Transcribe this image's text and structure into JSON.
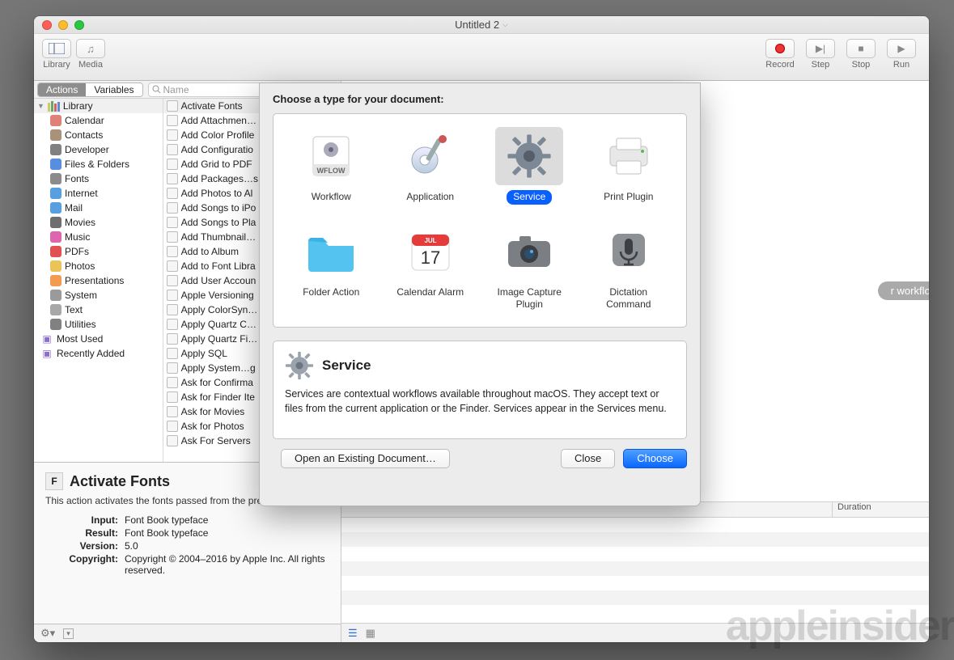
{
  "window": {
    "title": "Untitled 2"
  },
  "toolbar": {
    "left": [
      {
        "name": "library",
        "label": "Library"
      },
      {
        "name": "media",
        "label": "Media"
      }
    ],
    "right": [
      {
        "name": "record",
        "label": "Record"
      },
      {
        "name": "step",
        "label": "Step"
      },
      {
        "name": "stop",
        "label": "Stop"
      },
      {
        "name": "run",
        "label": "Run"
      }
    ]
  },
  "tabs": {
    "actions": "Actions",
    "variables": "Variables"
  },
  "search": {
    "placeholder": "Name"
  },
  "library": {
    "header": "Library",
    "categories": [
      {
        "label": "Calendar",
        "color": "#d86c5f"
      },
      {
        "label": "Contacts",
        "color": "#9a7f62"
      },
      {
        "label": "Developer",
        "color": "#6b6b6b"
      },
      {
        "label": "Files & Folders",
        "color": "#3a7ad9"
      },
      {
        "label": "Fonts",
        "color": "#777"
      },
      {
        "label": "Internet",
        "color": "#3a8edc"
      },
      {
        "label": "Mail",
        "color": "#3a8edc"
      },
      {
        "label": "Movies",
        "color": "#555"
      },
      {
        "label": "Music",
        "color": "#d64ca0"
      },
      {
        "label": "PDFs",
        "color": "#d33"
      },
      {
        "label": "Photos",
        "color": "#e7b93c"
      },
      {
        "label": "Presentations",
        "color": "#f08a33"
      },
      {
        "label": "System",
        "color": "#888"
      },
      {
        "label": "Text",
        "color": "#999"
      },
      {
        "label": "Utilities",
        "color": "#6b6b6b"
      }
    ],
    "smart": [
      {
        "label": "Most Used"
      },
      {
        "label": "Recently Added"
      }
    ]
  },
  "actions": [
    "Activate Fonts",
    "Add Attachmen…",
    "Add Color Profile",
    "Add Configuratio",
    "Add Grid to PDF",
    "Add Packages…s",
    "Add Photos to Al",
    "Add Songs to iPo",
    "Add Songs to Pla",
    "Add Thumbnail…",
    "Add to Album",
    "Add to Font Libra",
    "Add User Accoun",
    "Apple Versioning",
    "Apply ColorSyn…",
    "Apply Quartz C…",
    "Apply Quartz Fi…",
    "Apply SQL",
    "Apply System…g",
    "Ask for Confirma",
    "Ask for Finder Ite",
    "Ask for Movies",
    "Ask for Photos",
    "Ask For Servers"
  ],
  "detail": {
    "title": "Activate Fonts",
    "desc": "This action activates the fonts passed from the previous action.",
    "rows": {
      "input_k": "Input:",
      "input_v": "Font Book typeface",
      "result_k": "Result:",
      "result_v": "Font Book typeface",
      "version_k": "Version:",
      "version_v": "5.0",
      "copyright_k": "Copyright:",
      "copyright_v": "Copyright © 2004–2016 by Apple Inc. All rights reserved."
    }
  },
  "workflow_hint": "r workflow.",
  "log": {
    "col1": "",
    "col2": "Duration"
  },
  "sheet": {
    "heading": "Choose a type for your document:",
    "types": [
      {
        "name": "workflow",
        "label": "Workflow"
      },
      {
        "name": "application",
        "label": "Application"
      },
      {
        "name": "service",
        "label": "Service",
        "selected": true
      },
      {
        "name": "print-plugin",
        "label": "Print Plugin"
      },
      {
        "name": "folder-action",
        "label": "Folder Action"
      },
      {
        "name": "calendar-alarm",
        "label": "Calendar Alarm"
      },
      {
        "name": "image-capture-plugin",
        "label": "Image Capture\nPlugin"
      },
      {
        "name": "dictation-command",
        "label": "Dictation\nCommand"
      }
    ],
    "desc_title": "Service",
    "desc_body": "Services are contextual workflows available throughout macOS. They accept text or files from the current application or the Finder. Services appear in the Services menu.",
    "open": "Open an Existing Document…",
    "close": "Close",
    "choose": "Choose"
  },
  "watermark": "appleinsider"
}
